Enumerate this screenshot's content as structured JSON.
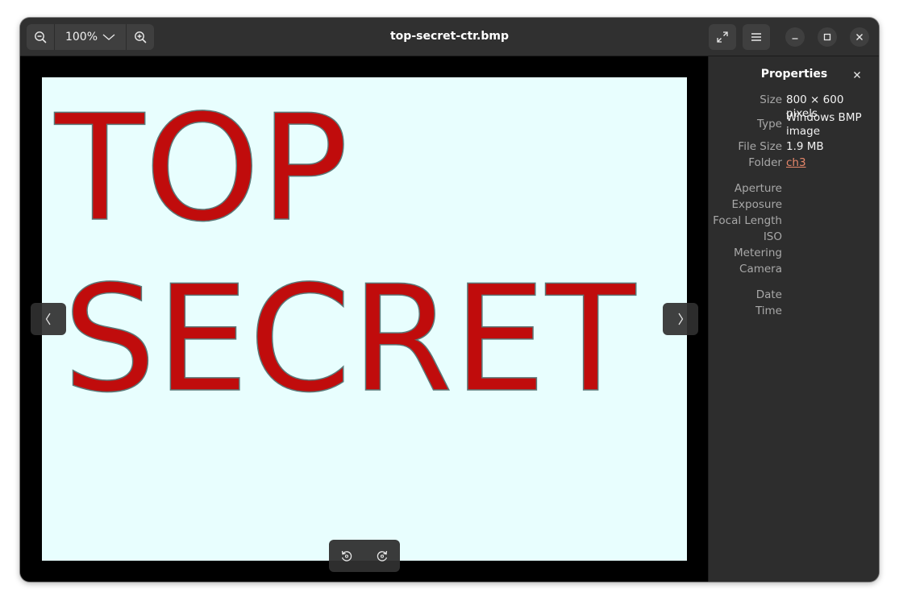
{
  "header": {
    "title": "top-secret-ctr.bmp",
    "zoom_level": "100%",
    "icons": {
      "zoom_out": "zoom-out-icon",
      "zoom_in": "zoom-in-icon",
      "dropdown": "chevron-down-icon",
      "fullscreen": "fullscreen-icon",
      "menu": "hamburger-menu-icon",
      "minimize": "minimize-icon",
      "maximize": "maximize-icon",
      "close": "close-icon"
    }
  },
  "image": {
    "line1": "TOP",
    "line2": "SECRET",
    "background_color": "#e8fefe",
    "text_color": "#c00c0c"
  },
  "navigation": {
    "previous_icon": "chevron-left-icon",
    "next_icon": "chevron-right-icon"
  },
  "toolbar": {
    "rotate_left_icon": "rotate-left-icon",
    "rotate_right_icon": "rotate-right-icon"
  },
  "properties": {
    "title": "Properties",
    "rows": [
      {
        "label": "Size",
        "value": "800 × 600 pixels"
      },
      {
        "label": "Type",
        "value": "Windows BMP image"
      },
      {
        "label": "File Size",
        "value": "1.9 MB"
      },
      {
        "label": "Folder",
        "value": "ch3",
        "link": true
      },
      {
        "label": "Aperture",
        "value": ""
      },
      {
        "label": "Exposure",
        "value": ""
      },
      {
        "label": "Focal Length",
        "value": ""
      },
      {
        "label": "ISO",
        "value": ""
      },
      {
        "label": "Metering",
        "value": ""
      },
      {
        "label": "Camera",
        "value": ""
      },
      {
        "label": "Date",
        "value": ""
      },
      {
        "label": "Time",
        "value": ""
      }
    ]
  },
  "colors": {
    "accent_link": "#e6876a",
    "headerbar": "#303030",
    "sidebar": "#2d2d2d"
  }
}
